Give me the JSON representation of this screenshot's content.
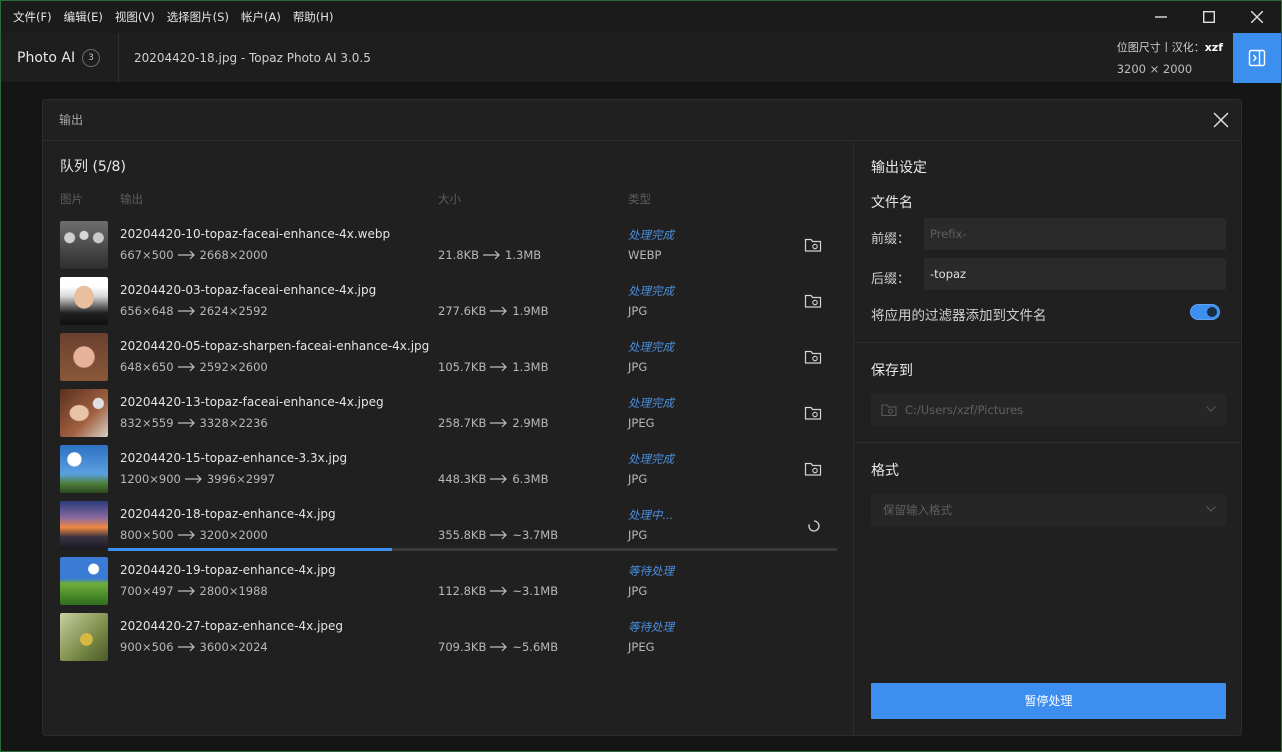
{
  "menu": [
    "文件(F)",
    "编辑(E)",
    "视图(V)",
    "选择图片(S)",
    "帐户(A)",
    "帮助(H)"
  ],
  "header": {
    "app_name": "Photo AI",
    "badge": "3",
    "doc_title": "20204420-18.jpg - Topaz Photo AI 3.0.5",
    "info_label": "位图尺寸丨汉化：",
    "info_author": "xzf",
    "dimensions": "3200 × 2000"
  },
  "dialog": {
    "title": "输出",
    "queue": {
      "title": "队列 (5/8)",
      "columns": {
        "image": "图片",
        "output": "输出",
        "size": "大小",
        "type": "类型"
      },
      "rows": [
        {
          "name": "20204420-10-topaz-faceai-enhance-4x.webp",
          "dim_in": "667×500",
          "dim_out": "2668×2000",
          "size_in": "21.8KB",
          "size_out": "1.3MB",
          "status": "处理完成",
          "type": "WEBP",
          "thumb": "vintage-group"
        },
        {
          "name": "20204420-03-topaz-faceai-enhance-4x.jpg",
          "dim_in": "656×648",
          "dim_out": "2624×2592",
          "size_in": "277.6KB",
          "size_out": "1.9MB",
          "status": "处理完成",
          "type": "JPG",
          "thumb": "portrait-man"
        },
        {
          "name": "20204420-05-topaz-sharpen-faceai-enhance-4x.jpg",
          "dim_in": "648×650",
          "dim_out": "2592×2600",
          "size_in": "105.7KB",
          "size_out": "1.3MB",
          "status": "处理完成",
          "type": "JPG",
          "thumb": "portrait-woman"
        },
        {
          "name": "20204420-13-topaz-faceai-enhance-4x.jpeg",
          "dim_in": "832×559",
          "dim_out": "3328×2236",
          "size_in": "258.7KB",
          "size_out": "2.9MB",
          "status": "处理完成",
          "type": "JPEG",
          "thumb": "portrait-flowers"
        },
        {
          "name": "20204420-15-topaz-enhance-3.3x.jpg",
          "dim_in": "1200×900",
          "dim_out": "3996×2997",
          "size_in": "448.3KB",
          "size_out": "6.3MB",
          "status": "处理完成",
          "type": "JPG",
          "thumb": "palm-sky"
        },
        {
          "name": "20204420-18-topaz-enhance-4x.jpg",
          "dim_in": "800×500",
          "dim_out": "3200×2000",
          "size_in": "355.8KB",
          "size_out": "~3.7MB",
          "status": "处理中...",
          "type": "JPG",
          "thumb": "sunset",
          "progress": 0.39
        },
        {
          "name": "20204420-19-topaz-enhance-4x.jpg",
          "dim_in": "700×497",
          "dim_out": "2800×1988",
          "size_in": "112.8KB",
          "size_out": "~3.1MB",
          "status": "等待处理",
          "type": "JPG",
          "thumb": "meadow"
        },
        {
          "name": "20204420-27-topaz-enhance-4x.jpeg",
          "dim_in": "900×506",
          "dim_out": "3600×2024",
          "size_in": "709.3KB",
          "size_out": "~5.6MB",
          "status": "等待处理",
          "type": "JPEG",
          "thumb": "bird"
        }
      ]
    },
    "settings": {
      "title": "输出设定",
      "filename_title": "文件名",
      "prefix_label": "前缀：",
      "prefix_placeholder": "Prefix-",
      "suffix_label": "后缀：",
      "suffix_value": "-topaz",
      "append_filters_label": "将应用的过滤器添加到文件名",
      "append_filters_on": true,
      "save_to_title": "保存到",
      "save_path": "C:/Users/xzf/Pictures",
      "format_title": "格式",
      "format_value": "保留输入格式",
      "pause_button": "暂停处理"
    }
  },
  "colors": {
    "accent": "#3d8fef",
    "status": "#4a8fe0"
  }
}
